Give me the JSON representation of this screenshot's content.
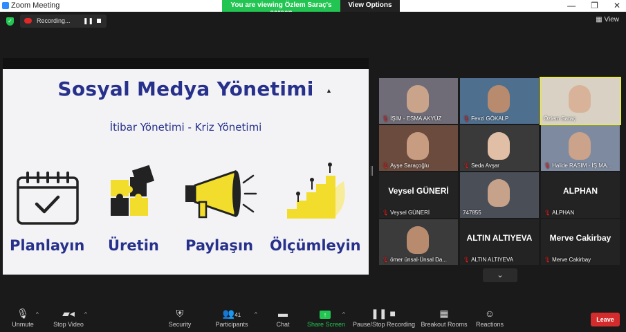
{
  "window": {
    "title": "Zoom Meeting",
    "controls": [
      "—",
      "❐",
      "✕"
    ]
  },
  "share_banner": {
    "viewing": "You are viewing Özlem Saraç's screen",
    "view_options": "View Options ⌄"
  },
  "recording": {
    "label": "Recording...",
    "pause_icon": "❚❚"
  },
  "view_button": "▦ View",
  "slide": {
    "title": "Sosyal Medya Yönetimi",
    "subtitle": "İtibar Yönetimi - Kriz Yönetimi",
    "items": [
      {
        "label": "Planlayın",
        "icon": "calendar-check-icon"
      },
      {
        "label": "Üretin",
        "icon": "puzzle-icon"
      },
      {
        "label": "Paylaşın",
        "icon": "megaphone-icon"
      },
      {
        "label": "Ölçümleyin",
        "icon": "growth-stairs-icon"
      }
    ]
  },
  "participants": [
    {
      "name": "İŞİM - ESMA AKYÜZ",
      "muted": true,
      "video": true
    },
    {
      "name": "Fevzi GÖKALP",
      "muted": true,
      "video": true
    },
    {
      "name": "Özlem Saraç",
      "muted": false,
      "video": true,
      "active": true
    },
    {
      "name": "Ayşe Saraçoğlu",
      "muted": true,
      "video": true
    },
    {
      "name": "Seda Avşar",
      "muted": true,
      "video": true
    },
    {
      "name": "Halide RASIM - İŞ MA...",
      "muted": true,
      "video": true
    },
    {
      "name": "Veysel GÜNERİ",
      "display": "Veysel GÜNERİ",
      "muted": true,
      "video": false
    },
    {
      "name": "747855",
      "muted": false,
      "video": true
    },
    {
      "name": "ALPHAN",
      "display": "ALPHAN",
      "muted": true,
      "video": false
    },
    {
      "name": "ömer ünsal-Ünsal Da...",
      "muted": true,
      "video": true
    },
    {
      "name": "ALTIN ALTIYEVA",
      "display": "ALTIN ALTIYEVA",
      "muted": true,
      "video": false
    },
    {
      "name": "Merve Cakirbay",
      "display": "Merve Cakirbay",
      "muted": true,
      "video": false
    }
  ],
  "toolbar": {
    "unmute": "Unmute",
    "stop_video": "Stop Video",
    "security": "Security",
    "participants": "Participants",
    "participant_count": "41",
    "chat": "Chat",
    "share_screen": "Share Screen",
    "pause_recording": "Pause/Stop Recording",
    "breakout_rooms": "Breakout Rooms",
    "reactions": "Reactions",
    "leave": "Leave"
  },
  "colors": {
    "slide_accent": "#27318b",
    "slide_yellow": "#f2dd2c",
    "share_green": "#23c552",
    "leave_red": "#d42c2c",
    "active_speaker": "#e8e842"
  }
}
